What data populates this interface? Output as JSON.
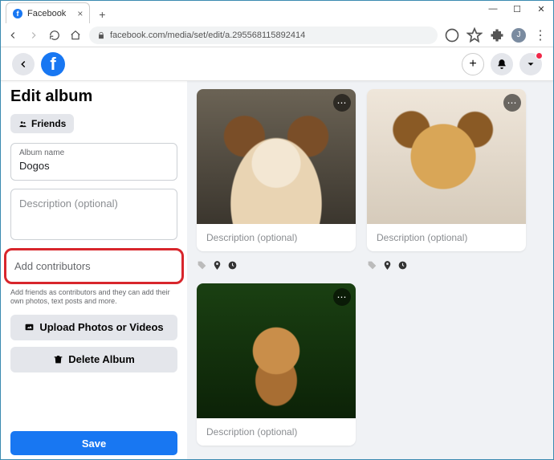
{
  "browser": {
    "tab_title": "Facebook",
    "url": "facebook.com/media/set/edit/a.295568115892414",
    "avatar_initial": "J"
  },
  "header": {
    "logo_glyph": "f"
  },
  "sidebar": {
    "title": "Edit album",
    "privacy_label": "Friends",
    "album_name_label": "Album name",
    "album_name_value": "Dogos",
    "description_placeholder": "Description (optional)",
    "contributors_placeholder": "Add contributors",
    "contributors_helper": "Add friends as contributors and they can add their own photos, text posts and more.",
    "upload_label": "Upload Photos or Videos",
    "delete_label": "Delete Album",
    "save_label": "Save"
  },
  "photos": [
    {
      "description_placeholder": "Description (optional)"
    },
    {
      "description_placeholder": "Description (optional)"
    },
    {
      "description_placeholder": "Description (optional)"
    }
  ]
}
